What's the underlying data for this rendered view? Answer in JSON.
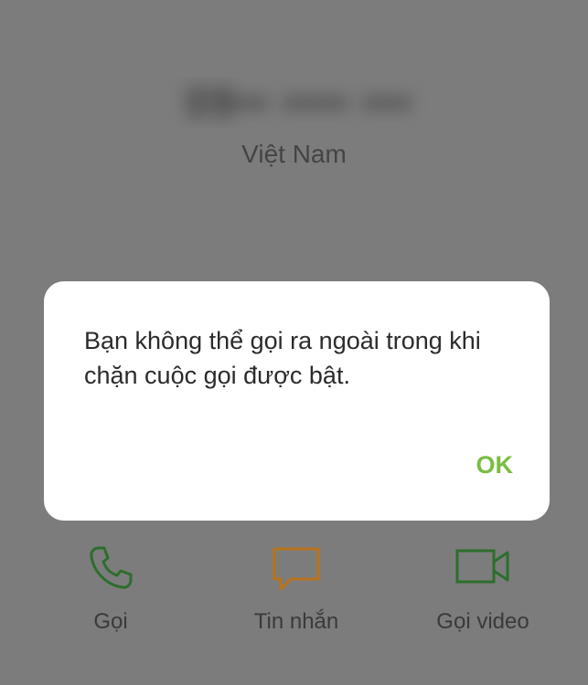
{
  "contact": {
    "number": "09•• •••• •••",
    "country": "Việt Nam"
  },
  "actions": {
    "call_label": "Gọi",
    "message_label": "Tin nhắn",
    "video_label": "Gọi video"
  },
  "dialog": {
    "message": "Bạn không thể gọi ra ngoài trong khi chặn cuộc gọi được bật.",
    "ok_label": "OK"
  },
  "colors": {
    "call_icon": "#2c6e2c",
    "message_icon": "#b8731a",
    "video_icon": "#2c6e2c",
    "ok_button": "#79bd43",
    "overlay": "#7c7c7c"
  },
  "icons": {
    "call": "phone-icon",
    "message": "message-bubble-icon",
    "video": "video-camera-icon"
  }
}
